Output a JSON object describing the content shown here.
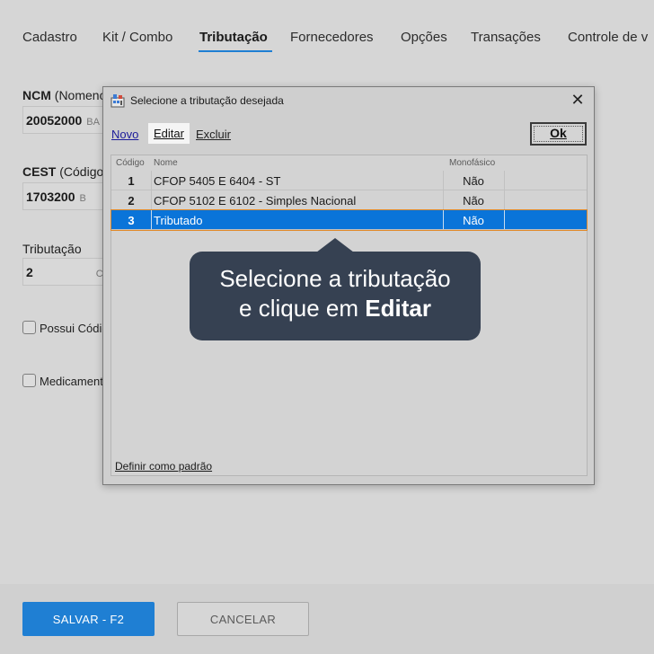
{
  "tabs": [
    {
      "label": "Cadastro"
    },
    {
      "label": "Kit / Combo"
    },
    {
      "label": "Tributação"
    },
    {
      "label": "Fornecedores"
    },
    {
      "label": "Opções"
    },
    {
      "label": "Transações"
    },
    {
      "label": "Controle de v"
    }
  ],
  "form": {
    "ncm_label": "NCM",
    "ncm_label_rest": "(Nomenc",
    "ncm_value": "20052000",
    "ncm_suffix": "BA",
    "cest_label": "CEST",
    "cest_label_rest": "(Código",
    "cest_value": "1703200",
    "cest_suffix": "B",
    "trib_label": "Tributação",
    "trib_value": "2",
    "trib_suffix": "C",
    "chk1_label": "Possui Códig",
    "chk2_label": "Medicament"
  },
  "footer": {
    "save_label": "SALVAR - F2",
    "cancel_label": "CANCELAR"
  },
  "dialog": {
    "title": "Selecione a tributação desejada",
    "link_new": "Novo",
    "link_edit": "Editar",
    "link_delete": "Excluir",
    "ok_label": "Ok",
    "columns": {
      "code": "Código",
      "name": "Nome",
      "mono": "Monofásico"
    },
    "rows": [
      {
        "code": "1",
        "name": "CFOP 5405 E 6404 - ST",
        "mono": "Não"
      },
      {
        "code": "2",
        "name": "CFOP 5102 E 6102 - Simples Nacional",
        "mono": "Não"
      },
      {
        "code": "3",
        "name": "Tributado",
        "mono": "Não"
      }
    ],
    "default_link": "Definir como padrão"
  },
  "tooltip": {
    "line1": "Selecione a tributação",
    "line2_prefix": "e clique em",
    "line2_bold": "Editar"
  },
  "colors": {
    "accent": "#1f7fd3",
    "selection": "#0a74d9",
    "tooltip_bg": "#364152"
  }
}
